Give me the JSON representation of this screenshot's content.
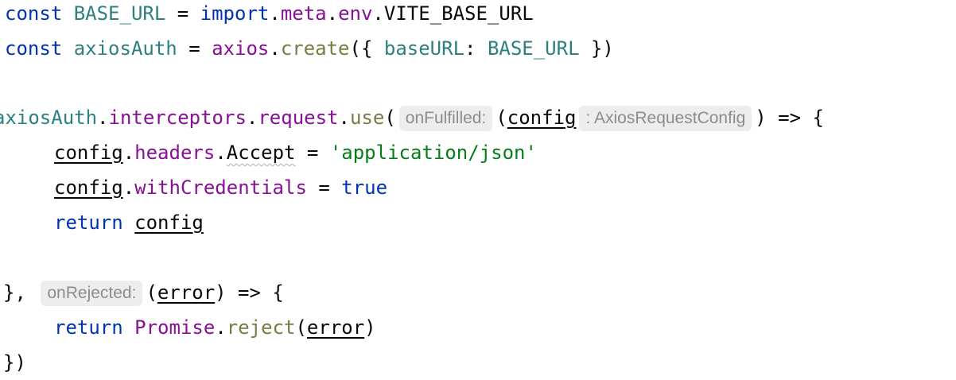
{
  "line1": {
    "kw": "const",
    "name": "BASE_URL",
    "eq": "=",
    "import": "import",
    "dot1": ".",
    "meta": "meta",
    "dot2": ".",
    "env": "env",
    "rest": ".VITE_BASE_URL"
  },
  "line2": {
    "kw": "const",
    "name": "axiosAuth",
    "eq": "=",
    "obj": "axios",
    "dot": ".",
    "fn": "create",
    "open": "({ ",
    "key": "baseURL",
    "colon": ": ",
    "val": "BASE_URL",
    "close": " })"
  },
  "line4": {
    "obj": "axiosAuth",
    "dot1": ".",
    "p1": "interceptors",
    "dot2": ".",
    "p2": "request",
    "dot3": ".",
    "fn": "use",
    "open": "(",
    "hint1": "onFulfilled:",
    "paren": "(",
    "param": "config",
    "hint2": ": AxiosRequestConfig",
    "close": ") => {"
  },
  "line5": {
    "obj": "config",
    "dot1": ".",
    "p1": "headers",
    "dot2": ".",
    "p2": "Accept",
    "eq": " = ",
    "str": "'application/json'"
  },
  "line6": {
    "obj": "config",
    "dot": ".",
    "p": "withCredentials",
    "eq": " = ",
    "val": "true"
  },
  "line7": {
    "kw": "return",
    "val": "config"
  },
  "line9": {
    "start": "},",
    "hint": "onRejected:",
    "open": "(",
    "param": "error",
    "close": ") => {"
  },
  "line10": {
    "kw": "return",
    "obj": "Promise",
    "dot": ".",
    "fn": "reject",
    "open": "(",
    "arg": "error",
    "close": ")"
  },
  "line11": {
    "text": "})"
  }
}
